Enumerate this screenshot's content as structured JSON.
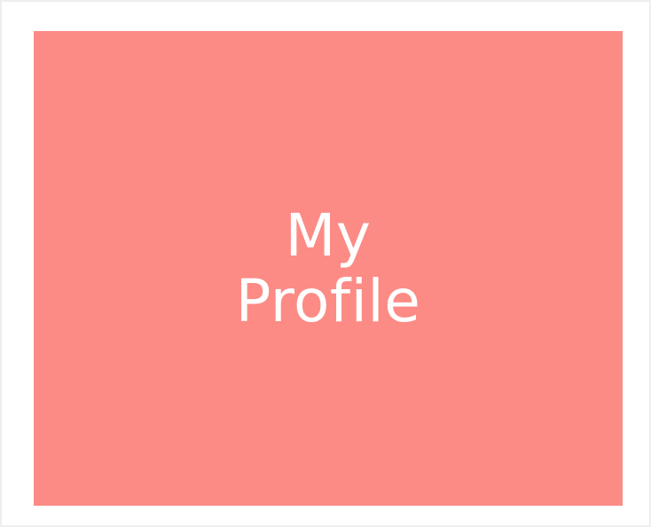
{
  "tile": {
    "title_line1": "My",
    "title_line2": "Profile"
  },
  "colors": {
    "tile_background": "#fc8b86",
    "text": "#ffffff",
    "page_background": "#ffffff"
  }
}
